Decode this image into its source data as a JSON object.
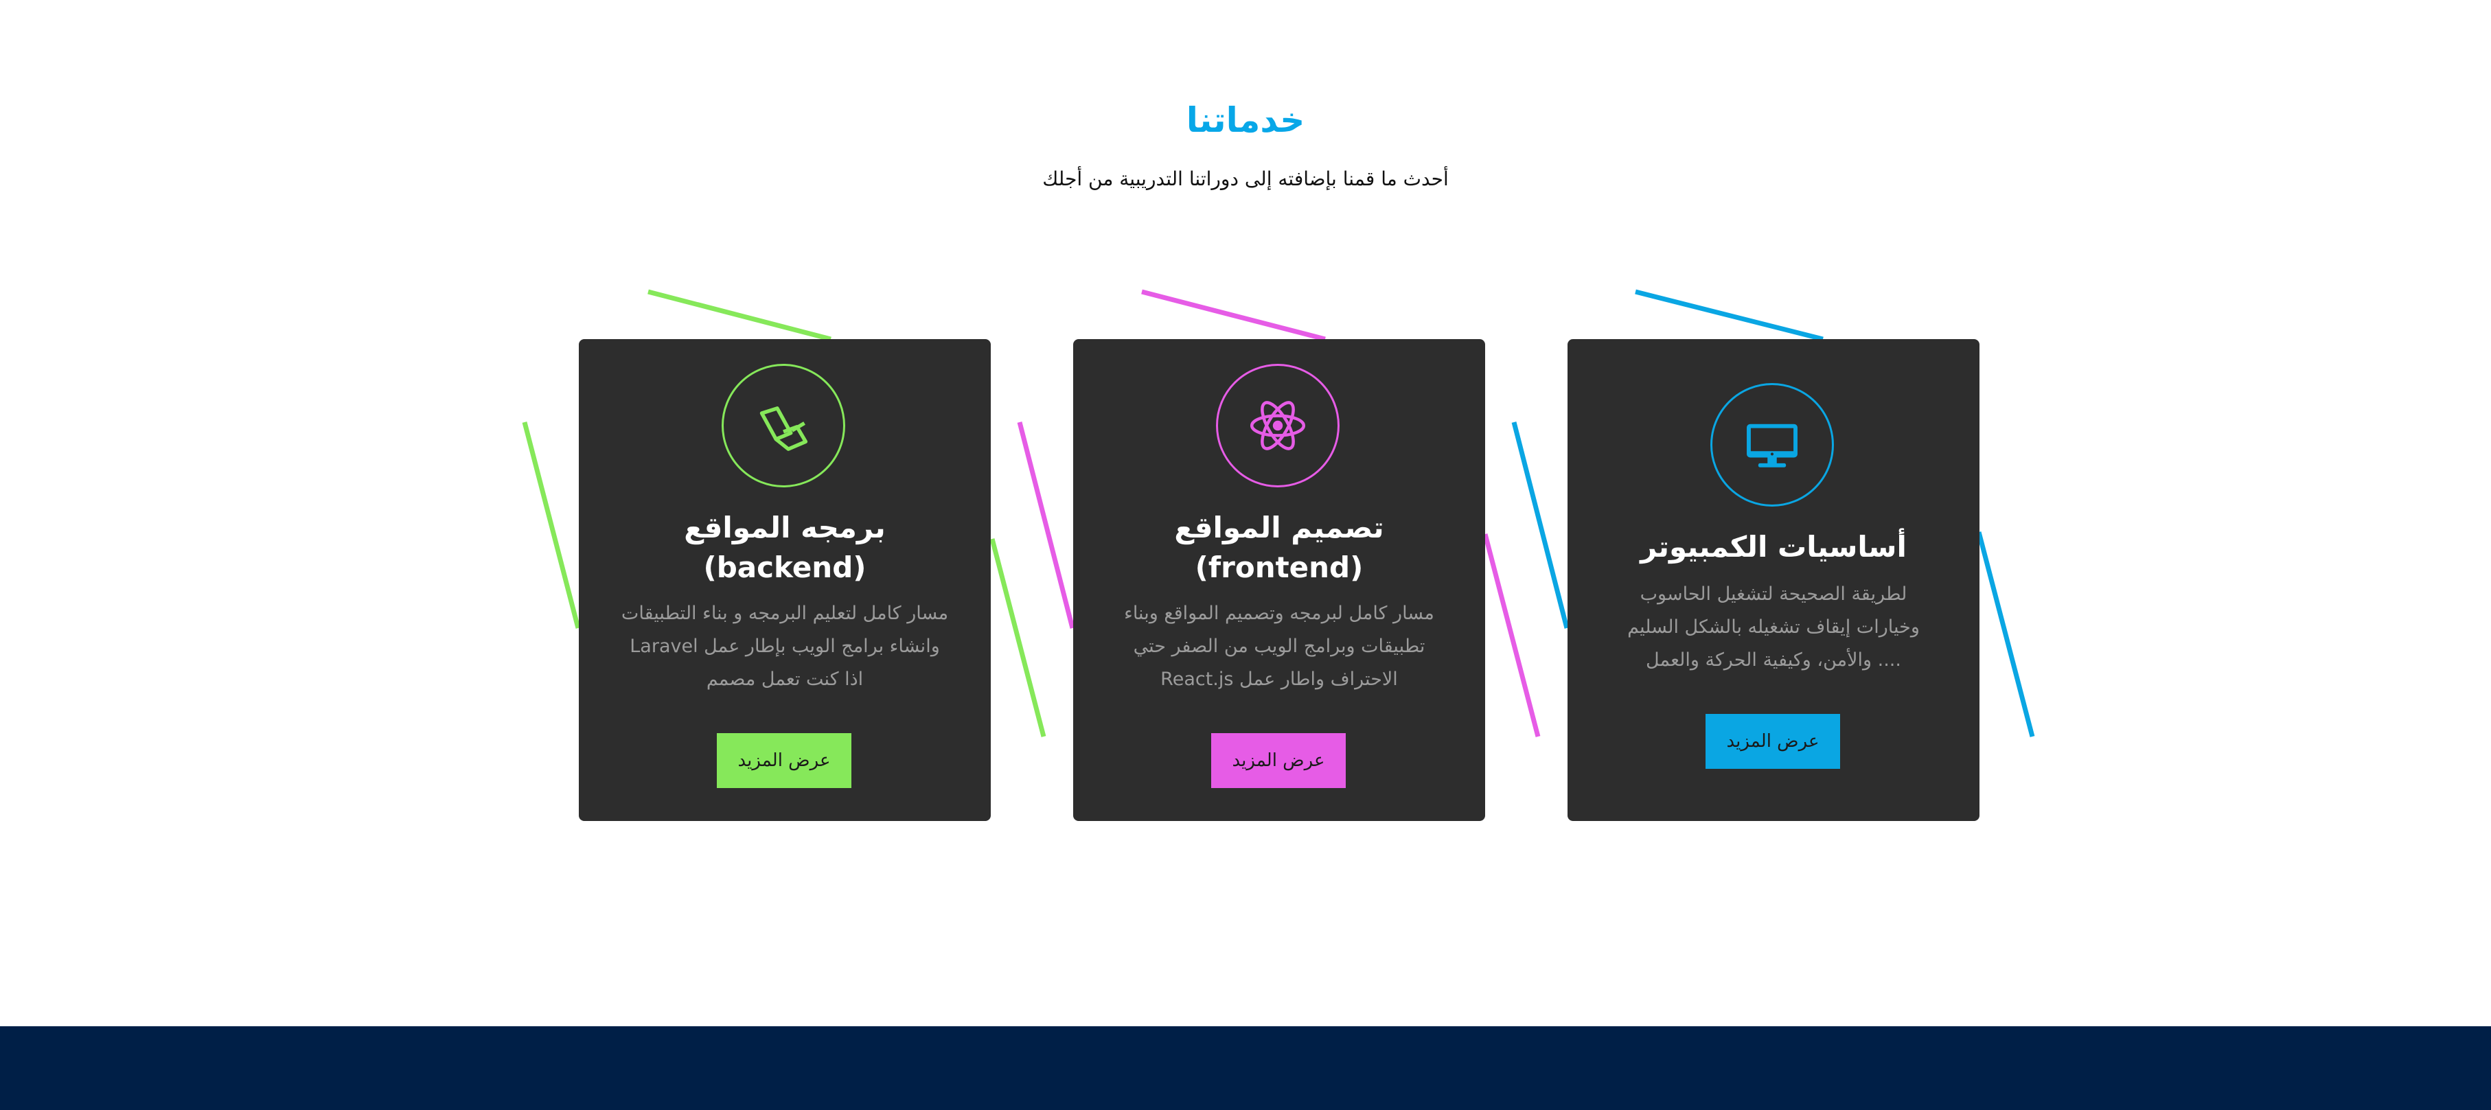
{
  "section": {
    "title": "خدماتنا",
    "subtitle": "أحدث ما قمنا بإضافته إلى دوراتنا التدريبية من أجلك"
  },
  "colors": {
    "title": "#08a7e8",
    "card_bg": "#2d2d2d",
    "green": "#86e85a",
    "pink": "#e65ce6",
    "blue": "#0aa6e3",
    "footer": "#001f47",
    "desc_text": "#9b9b9b"
  },
  "cards": [
    {
      "accent": "#86e85a",
      "icon": "laravel-icon",
      "title_line1": "برمجه المواقع",
      "title_line2": "(backend)",
      "desc_line1": "مسار كامل لتعليم البرمجه و بناء التطبيقات",
      "desc_line2": "Laravel وانشاء برامج الويب بإطار عمل",
      "desc_line3": "اذا كنت تعمل مصمم",
      "button": "عرض المزيد"
    },
    {
      "accent": "#e65ce6",
      "icon": "react-icon",
      "title_line1": "تصميم المواقع",
      "title_line2": "(frontend)",
      "desc_line1": "مسار كامل لبرمجه وتصميم المواقع وبناء",
      "desc_line2": "تطبيقات وبرامج الويب من الصفر حتي",
      "desc_line3": "React.js الاحتراف واطار عمل",
      "button": "عرض المزيد"
    },
    {
      "accent": "#0aa6e3",
      "icon": "desktop-monitor-icon",
      "title_line1": "أساسيات الكمبيوتر",
      "desc_line1": "لطريقة الصحيحة لتشغيل الحاسوب",
      "desc_line2": "وخيارات إيقاف تشغيله بالشكل السليم",
      "desc_line3": "والأمن، وكيفية الحركة والعمل ....",
      "button": "عرض المزيد"
    }
  ]
}
